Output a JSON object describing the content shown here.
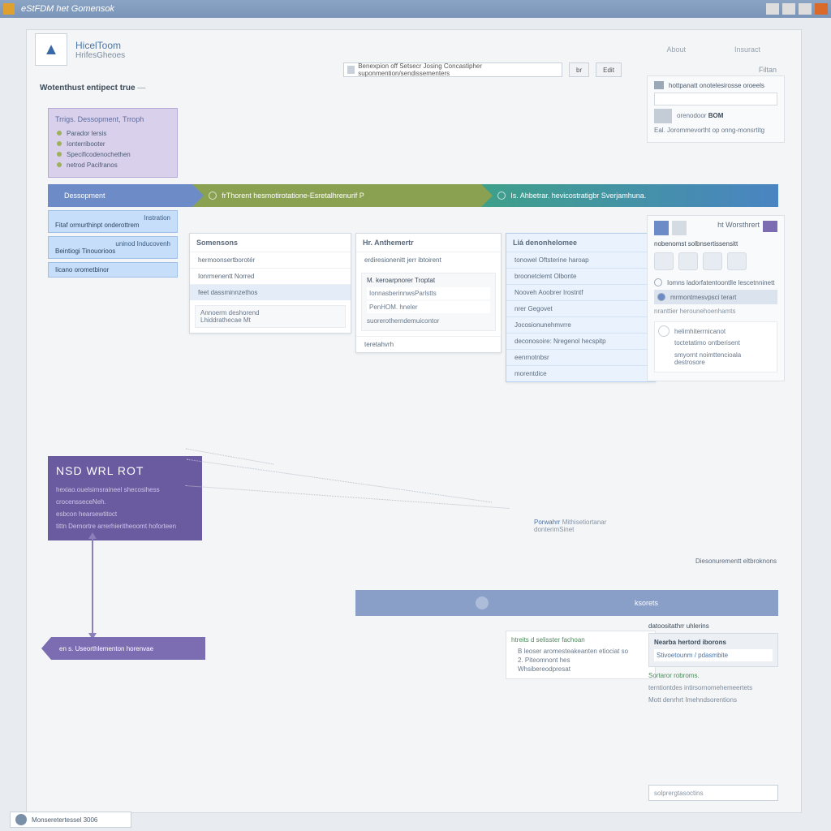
{
  "window": {
    "title": "eStFDM het Gomensok"
  },
  "header": {
    "appTitle": "HicelToom",
    "appSub": "HrifesGheoes",
    "tabs": [
      "About",
      "Insuract"
    ],
    "search_placeholder": "Benexpion off Setsecr Josing Concastipher suponmention/sendissementers",
    "btn_go": "br",
    "btn_edit": "Edit",
    "filter": "Filtan"
  },
  "breadcrumb": {
    "text": "Wotenthust entipect true",
    "dash": "—"
  },
  "stageBox": {
    "title": "Trrigs. Dessopment, Trroph",
    "items": [
      "Parador lersis",
      "Ionterribooter",
      "Specificodenochethen",
      "netrod Pacifranos"
    ]
  },
  "chevrons": {
    "c1": "Dessopment",
    "c2": "frThorent hesmotirotatione-Esretalhrenurif P",
    "c3": "Is. Ahbetrar. hevicostratigbr Sverjamhuna."
  },
  "sidecards": [
    {
      "t": "Instration",
      "d": "Fitaf ormurthinpt onderottrem"
    },
    {
      "t": "uninod Inducovenh",
      "d": "Beintiogi Tinouorioos"
    },
    {
      "t": "Iicano orometbinor"
    }
  ],
  "panel1": {
    "title": "Somensons",
    "rows": [
      "hermoonsertborotér",
      "Ionrmenentt Norred",
      "feet dassminnzethos"
    ],
    "sect": [
      "Annoerm deshorend",
      "Lhiddrathecae Mt"
    ]
  },
  "panel2": {
    "title": "Hr. Anthemertr",
    "rows": [
      "erdiresionenitt jerr ibtoirent"
    ],
    "sect_head": "M. keroarpnorer Troptat",
    "sect_rows": [
      "IonnasberinnwsParlstts",
      "PenHOM. hneler",
      "suorerotherndemuicontor"
    ],
    "bottom": "teretahvrh"
  },
  "panel3": {
    "title": "Liá denonhelomee",
    "rows": [
      "tonowel Oftsterine haroap",
      "broonetclemt Olbonte",
      "Nooveh Aoobrer Irostntf",
      "nrer Gegovet",
      "Jocosionunehmvrre",
      "deconosoire: Nregenol hecspitp",
      "eenrnotnbsr",
      "morentdice"
    ]
  },
  "rpanel1": {
    "head": "hottpanatt onotelesirosse oroeels",
    "meta_label": "orenodoor",
    "meta_value": "BOM",
    "meta2": "Eal. Jorommevortht op onng-monsrtitg"
  },
  "rpanel2": {
    "title": "ht Worsthrert",
    "subtitle": "nobenomst solbnsertissensitt",
    "opt1": "Iomns ladorfatentoontlle lescetnninett",
    "opt2": "mrmontmesvpsci terart",
    "sub_detail": "nranttier herounehoenhamts",
    "card_rows": [
      "helimhiterrnicanot",
      "toctetatimo ontberisent",
      "smyornt noimttencioala destrosore"
    ]
  },
  "purple": {
    "title": "NSD   WRL ROT",
    "lines": [
      "hexiao.ouelsimsraineel shecosihess",
      "crocensseceNeh.",
      "esbcon hearsewtitoct",
      "tittn Dernortre arrerhieritheoomt hoforteen"
    ]
  },
  "purpleChev": "en s. Useorthlementon horenvae",
  "centerLabel": {
    "l1": "Porwahrr",
    "l2": "Mithisetiortanar",
    "l3": "donterimSinet"
  },
  "bluebar": "ksorets",
  "note1": {
    "head": "htreits d selisster fachoan",
    "lines": [
      "B leoser aromesteakeanten etiociat so",
      "2. Piteomnont hes",
      "Whsibereodpresat"
    ]
  },
  "note2": {
    "title": "datoositathrr uhlerins",
    "card_head": "Nearba hertord iborons",
    "card_line": "Stivoetounm / pdasmbite",
    "ft1": "Sortaror robroms.",
    "ft2": "terntiontdes intirsornomehemeertets",
    "ft3": "Mott denrhrt Imehndsorentions"
  },
  "footerChip": "Monseretertessel 3006",
  "footerInput": "solprergtasoctins",
  "rTopLabel": "Diesonurementt eltbroknons"
}
